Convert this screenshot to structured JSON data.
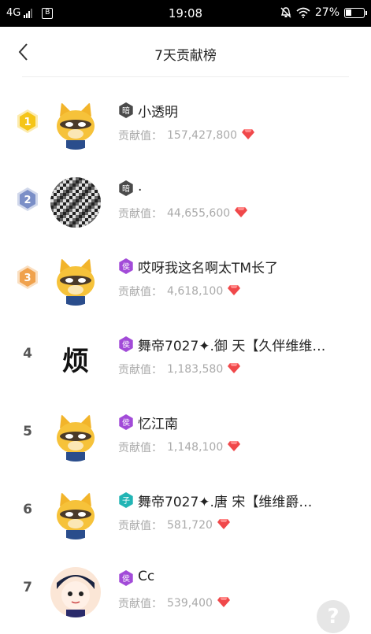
{
  "status_bar": {
    "network": "4G",
    "sim": "B",
    "time": "19:08",
    "battery": "27%",
    "icons": [
      "signal-icon",
      "sim-icon",
      "mute-icon",
      "wifi-icon",
      "battery-icon"
    ]
  },
  "nav": {
    "title": "7天贡献榜",
    "back_icon": "chevron-left-icon"
  },
  "contribution_label": "贡献值：",
  "colors": {
    "gold": "#f5c518",
    "silver": "#7b8fc7",
    "bronze": "#f0a24d",
    "level_purple": "#a24bd8",
    "level_dark": "#4a4a4a",
    "level_teal": "#22b5b5",
    "gem": "#f0484a"
  },
  "rows": [
    {
      "rank": "1",
      "badge": "gold",
      "name": "小透明",
      "level_glyph": "暗",
      "level_color": "level_dark",
      "value": "157,427,800",
      "avatar": "raccoon"
    },
    {
      "rank": "2",
      "badge": "silver",
      "name": ".",
      "level_glyph": "暗",
      "level_color": "level_dark",
      "value": "44,655,600",
      "avatar": "pattern"
    },
    {
      "rank": "3",
      "badge": "bronze",
      "name": "哎呀我这名啊太TM长了",
      "level_glyph": "侯",
      "level_color": "level_purple",
      "value": "4,618,100",
      "avatar": "raccoon"
    },
    {
      "rank": "4",
      "badge": "",
      "name": "舞帝7027✦.御 天【久伴维维…",
      "level_glyph": "侯",
      "level_color": "level_purple",
      "value": "1,183,580",
      "avatar": "text",
      "avatar_text": "烦"
    },
    {
      "rank": "5",
      "badge": "",
      "name": "忆江南",
      "level_glyph": "侯",
      "level_color": "level_purple",
      "value": "1,148,100",
      "avatar": "raccoon"
    },
    {
      "rank": "6",
      "badge": "",
      "name": "舞帝7027✦.唐 宋【维维爵…",
      "level_glyph": "子",
      "level_color": "level_teal",
      "value": "581,720",
      "avatar": "raccoon"
    },
    {
      "rank": "7",
      "badge": "",
      "name": "Cc",
      "level_glyph": "侯",
      "level_color": "level_purple",
      "value": "539,400",
      "avatar": "cartoon"
    }
  ],
  "help": {
    "label": "?"
  }
}
